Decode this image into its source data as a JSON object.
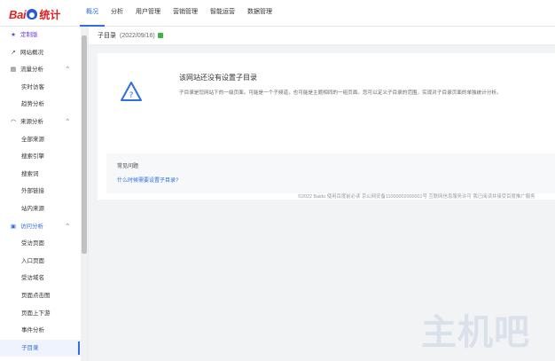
{
  "logo": {
    "bai": "Bai",
    "tongji": "统计"
  },
  "nav": [
    "概况",
    "分析",
    "用户管理",
    "营销管理",
    "智能运营",
    "数据管理"
  ],
  "sidebar": {
    "custom": {
      "label": "定制版",
      "icon": "star-icon"
    },
    "overview": {
      "label": "网站概况",
      "icon": "chart-line-icon"
    },
    "traffic": {
      "label": "流量分析",
      "caret": "^",
      "items": [
        "实时访客",
        "趋势分析"
      ]
    },
    "source": {
      "label": "来源分析",
      "caret": "^",
      "items": [
        "全部来源",
        "搜索引擎",
        "搜索词",
        "外部链接",
        "站内来源"
      ]
    },
    "visit": {
      "label": "访问分析",
      "caret": "^",
      "items": [
        "受访页面",
        "入口页面",
        "受访域名",
        "页面点击图",
        "页面上下游",
        "事件分析",
        "子目录"
      ]
    }
  },
  "subhead": {
    "title": "子目录",
    "date": "(2022/09/16)"
  },
  "empty": {
    "title": "该网站还没有设置子目录",
    "desc": "子目录是您网站下的一级页面。可能是一个子频道，也可能是主题相同的一组页面。您可以定义子目录的范围，实现对子目录页面的单独统计分析。"
  },
  "faq": {
    "title": "常见问题",
    "link": "什么时候需要设置子目录?"
  },
  "footer": "©2022 Baidu 使用百度前必读 京公网安备11000002000001号 互联网信息服务许可 我已阅读并接受百度推广服务",
  "watermark": "主机吧",
  "colors": {
    "accent": "#2f6fe0",
    "brand_red": "#e02020",
    "custom_purple": "#6b3fd4"
  }
}
